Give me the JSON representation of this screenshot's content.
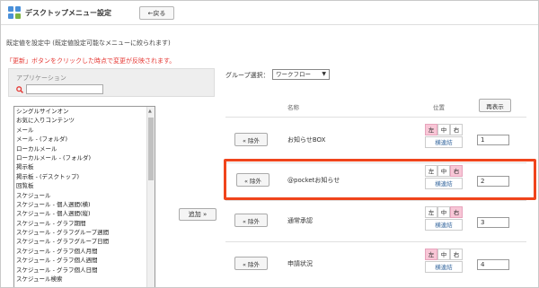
{
  "header": {
    "title": "デスクトップメニュー設定",
    "back_label": "←戻る"
  },
  "info_text": "既定値を設定中 (既定値設定可能なメニューに絞られます)",
  "warning_text": "「更新」ボタンをクリックした時点で変更が反映されます。",
  "left_panel": {
    "label": "アプリケーション",
    "search_icon": "search-icon",
    "items": [
      "シングルサインオン",
      "お気に入りコンテンツ",
      "メール",
      "メール - (フォルダ)",
      "ローカルメール",
      "ローカルメール - (フォルダ)",
      "掲示板",
      "掲示板 - (デスクトップ)",
      "回覧板",
      "スケジュール",
      "スケジュール - 個人週間(横)",
      "スケジュール - 個人週間(縦)",
      "スケジュール - グラフ期間",
      "スケジュール - グラフグループ週間",
      "スケジュール - グラフグループ日間",
      "スケジュール - グラフ個人月間",
      "スケジュール - グラフ個人週間",
      "スケジュール - グラフ個人日間",
      "スケジュール検索"
    ]
  },
  "add_label": "追加 »",
  "group_select": {
    "label": "グループ選択：",
    "value": "ワークフロー"
  },
  "table": {
    "col_name": "名称",
    "col_position": "位置",
    "refresh_label": "再表示",
    "remove_label": "« 除外",
    "pos_left": "左",
    "pos_center": "中",
    "pos_right": "右",
    "yoko_label": "横連結",
    "rows": [
      {
        "name": "お知らせBOX",
        "selected": "left",
        "order": "1"
      },
      {
        "name": "@pocketお知らせ",
        "selected": "right",
        "order": "2"
      },
      {
        "name": "通常承認",
        "selected": "right",
        "order": "3"
      },
      {
        "name": "申請状況",
        "selected": "left",
        "order": "4"
      }
    ]
  },
  "colors": {
    "highlight": "#f0441c",
    "selected_pos": "#f8c6d6",
    "warning": "#e53935"
  }
}
